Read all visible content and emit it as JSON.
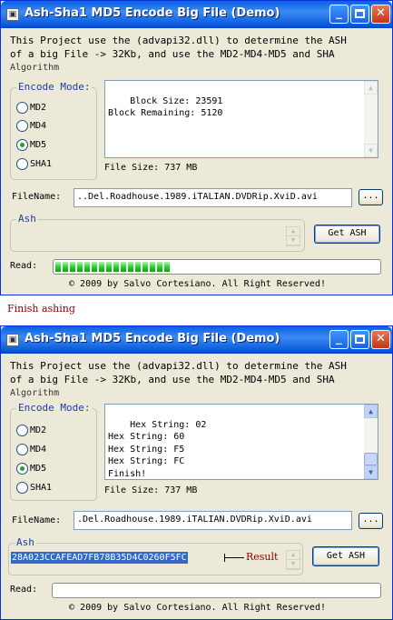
{
  "colors": {
    "title_bar": "#0a5fe3",
    "window_bg": "#ece9d8",
    "group_label": "#1a3ca8",
    "progress_fill": "#2cd22c",
    "annotation": "#8b0000",
    "selection": "#316ac5"
  },
  "window1": {
    "title": "Ash-Sha1 MD5 Encode Big File (Demo)",
    "title_icon": "app-icon",
    "description_line1": "This Project use the (advapi32.dll) to determine the ASH",
    "description_line2": "of a big File -> 32Kb, and use the MD2-MD4-MD5 and SHA",
    "description_line3": "Algorithm",
    "encode_mode_label": "Encode Mode:",
    "modes": [
      "MD2",
      "MD4",
      "MD5",
      "SHA1"
    ],
    "selected_mode": "MD5",
    "output_text": "Block Size: 23591\nBlock Remaining: 5120",
    "file_size": "File Size: 737 MB",
    "filename_label": "FileName:",
    "filename_value": "..Del.Roadhouse.1989.iTALIAN.DVDRip.XviD.avi",
    "browse_label": "...",
    "ash_group_label": "Ash",
    "ash_value": "",
    "get_ash_label": "Get ASH",
    "read_label": "Read:",
    "progress_percent": 36,
    "footer": "© 2009 by Salvo Cortesiano. All Right Reserved!"
  },
  "caption": "Finish ashing",
  "window2": {
    "title": "Ash-Sha1 MD5 Encode Big File (Demo)",
    "title_icon": "app-icon",
    "description_line1": "This Project use the (advapi32.dll) to determine the ASH",
    "description_line2": "of a big File -> 32Kb, and use the MD2-MD4-MD5 and SHA",
    "description_line3": "Algorithm",
    "encode_mode_label": "Encode Mode:",
    "modes": [
      "MD2",
      "MD4",
      "MD5",
      "SHA1"
    ],
    "selected_mode": "MD5",
    "output_text": "Hex String: 02\nHex String: 60\nHex String: F5\nHex String: FC\nFinish!",
    "file_size": "File Size: 737 MB",
    "filename_label": "FileName:",
    "filename_value": ".Del.Roadhouse.1989.iTALIAN.DVDRip.XviD.avi",
    "browse_label": "...",
    "ash_group_label": "Ash",
    "ash_value": "28A023CCAFEAD7FB78B35D4C0260F5FC",
    "result_annotation": "Result",
    "get_ash_label": "Get ASH",
    "read_label": "Read:",
    "progress_percent": 0,
    "footer": "© 2009 by Salvo Cortesiano. All Right Reserved!"
  }
}
